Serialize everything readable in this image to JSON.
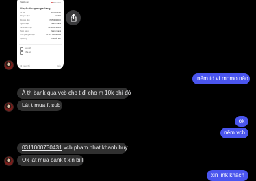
{
  "shared_image": {
    "header_left": "Tài khoản",
    "header_right": "Transfer",
    "title": "Chuyển tiền qua ngân hàng",
    "rows": [
      {
        "label": "Số tiền",
        "value": "10.000 VND"
      },
      {
        "label": "Phí giao dịch",
        "value": "0 VND"
      },
      {
        "label": "Mã giao dịch",
        "value": "FT2509000000"
      },
      {
        "label": "Người nhận",
        "value": "Vietcombank"
      },
      {
        "label": "Tài khoản nhận",
        "value": "0311000730431"
      },
      {
        "label": "Ngân hàng",
        "value": "Vietcombank"
      },
      {
        "label": "Thời gian giao dịch",
        "value": "08:12 - 01/09/2023"
      },
      {
        "label": "Nội dung",
        "value": "Chuyển tiền"
      }
    ],
    "actions": [
      "Lưu ảnh",
      "Chia sẻ"
    ],
    "footer_left": "Về trang chủ",
    "footer_right": "Hủy"
  },
  "messages": {
    "out_1": "nếm td ví momo nào",
    "in_1": "À th bank qua vcb cho t đi cho m 10k phí đó",
    "in_2": "Lát t mua ít sub",
    "out_2": "ok",
    "out_3": "nếm vcb",
    "in_3_account": "0311000730431",
    "in_3_rest": " vcb pham nhat khanh huy",
    "in_4": "Ok lát mua bank t xin bill",
    "out_4": "xin link khách"
  },
  "colors": {
    "background": "#000000",
    "incoming_bubble": "#303030",
    "outgoing_bubble": "#4a55ee",
    "share_button": "#3a3a3c"
  },
  "icons": {
    "share": "share-icon",
    "avatar": "contact-avatar"
  }
}
